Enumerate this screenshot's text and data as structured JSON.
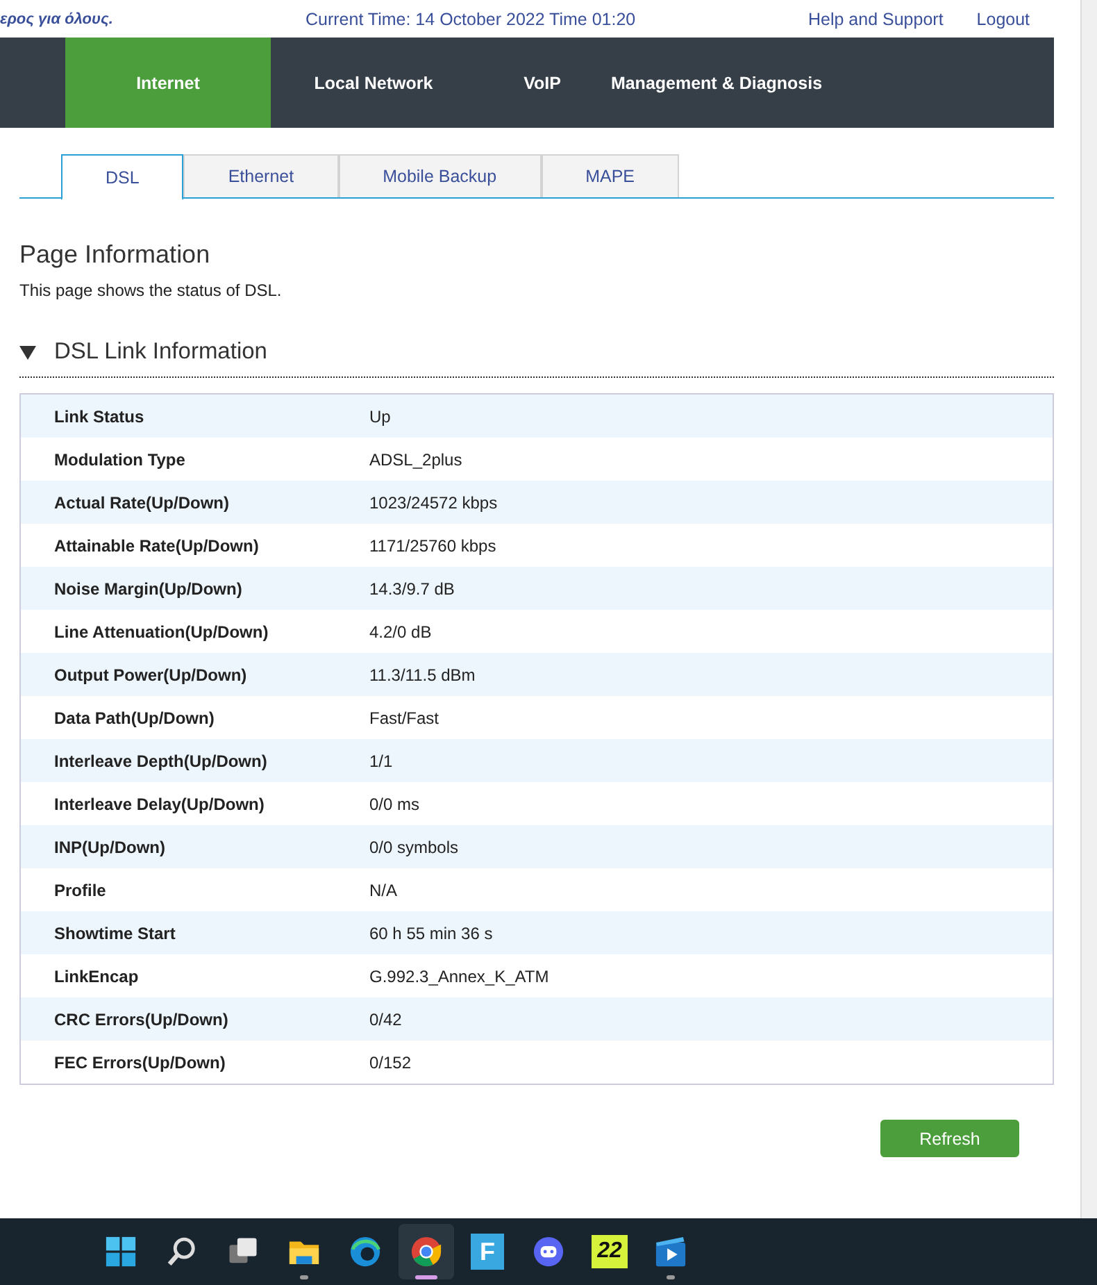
{
  "header": {
    "slogan": "ερος για όλους.",
    "current_time": "Current Time: 14 October 2022 Time 01:20",
    "links": [
      "Help and Support",
      "Logout"
    ]
  },
  "nav": [
    {
      "label": "Internet",
      "selected": true
    },
    {
      "label": "Local Network",
      "selected": false
    },
    {
      "label": "VoIP",
      "selected": false
    },
    {
      "label": "Management & Diagnosis",
      "selected": false
    }
  ],
  "tabs": [
    {
      "label": "DSL",
      "selected": true
    },
    {
      "label": "Ethernet",
      "selected": false
    },
    {
      "label": "Mobile Backup",
      "selected": false
    },
    {
      "label": "MAPE",
      "selected": false
    }
  ],
  "page_title": "Page Information",
  "page_description": "This page shows the status of DSL.",
  "section": {
    "title": "DSL Link Information",
    "expanded": true,
    "rows": [
      {
        "label": "Link Status",
        "value": "Up"
      },
      {
        "label": "Modulation Type",
        "value": "ADSL_2plus"
      },
      {
        "label": "Actual Rate(Up/Down)",
        "value": "1023/24572 kbps"
      },
      {
        "label": "Attainable Rate(Up/Down)",
        "value": "1171/25760 kbps"
      },
      {
        "label": "Noise Margin(Up/Down)",
        "value": "14.3/9.7 dB"
      },
      {
        "label": "Line Attenuation(Up/Down)",
        "value": "4.2/0 dB"
      },
      {
        "label": "Output Power(Up/Down)",
        "value": "11.3/11.5 dBm"
      },
      {
        "label": "Data Path(Up/Down)",
        "value": "Fast/Fast"
      },
      {
        "label": "Interleave Depth(Up/Down)",
        "value": "1/1"
      },
      {
        "label": "Interleave Delay(Up/Down)",
        "value": "0/0 ms"
      },
      {
        "label": "INP(Up/Down)",
        "value": "0/0 symbols"
      },
      {
        "label": "Profile",
        "value": "N/A"
      },
      {
        "label": "Showtime Start",
        "value": "60 h 55 min 36 s"
      },
      {
        "label": "LinkEncap",
        "value": "G.992.3_Annex_K_ATM"
      },
      {
        "label": "CRC Errors(Up/Down)",
        "value": "0/42"
      },
      {
        "label": "FEC Errors(Up/Down)",
        "value": "0/152"
      }
    ]
  },
  "refresh_button": "Refresh",
  "taskbar": [
    {
      "kind": "start",
      "running": false,
      "selected": false
    },
    {
      "kind": "search",
      "running": false,
      "selected": false
    },
    {
      "kind": "taskview",
      "running": false,
      "selected": false
    },
    {
      "kind": "folder",
      "running": true,
      "selected": false
    },
    {
      "kind": "edge",
      "running": false,
      "selected": false
    },
    {
      "kind": "chrome",
      "running": true,
      "selected": true
    },
    {
      "kind": "letter",
      "text": "F",
      "running": false,
      "selected": false
    },
    {
      "kind": "chat",
      "running": false,
      "selected": false
    },
    {
      "kind": "number",
      "text": "22",
      "running": false,
      "selected": false
    },
    {
      "kind": "player",
      "running": true,
      "selected": false
    }
  ]
}
